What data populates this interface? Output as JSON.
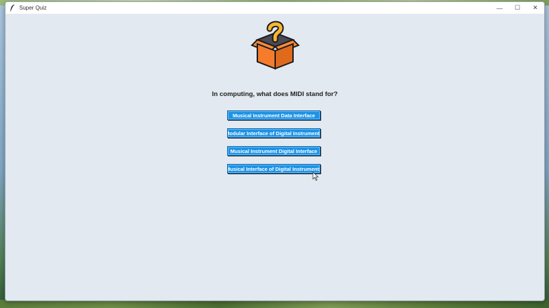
{
  "window": {
    "title": "Super Quiz",
    "app_icon": "feather-icon",
    "controls": {
      "minimize": "—",
      "maximize": "☐",
      "close": "✕"
    }
  },
  "quiz": {
    "icon": "mystery-box-icon",
    "question": "In computing, what does MIDI stand for?",
    "answers": [
      "Musical Instrument Data Interface",
      "Modular Interface of Digital Instruments",
      "Musical Instrument Digital Interface",
      "Musical Interface of Digital Instruments"
    ]
  },
  "colors": {
    "button_bg": "#1e93e6",
    "window_bg": "#e2e9f0",
    "box_orange": "#f47c2c",
    "question_mark": "#f7b733"
  }
}
